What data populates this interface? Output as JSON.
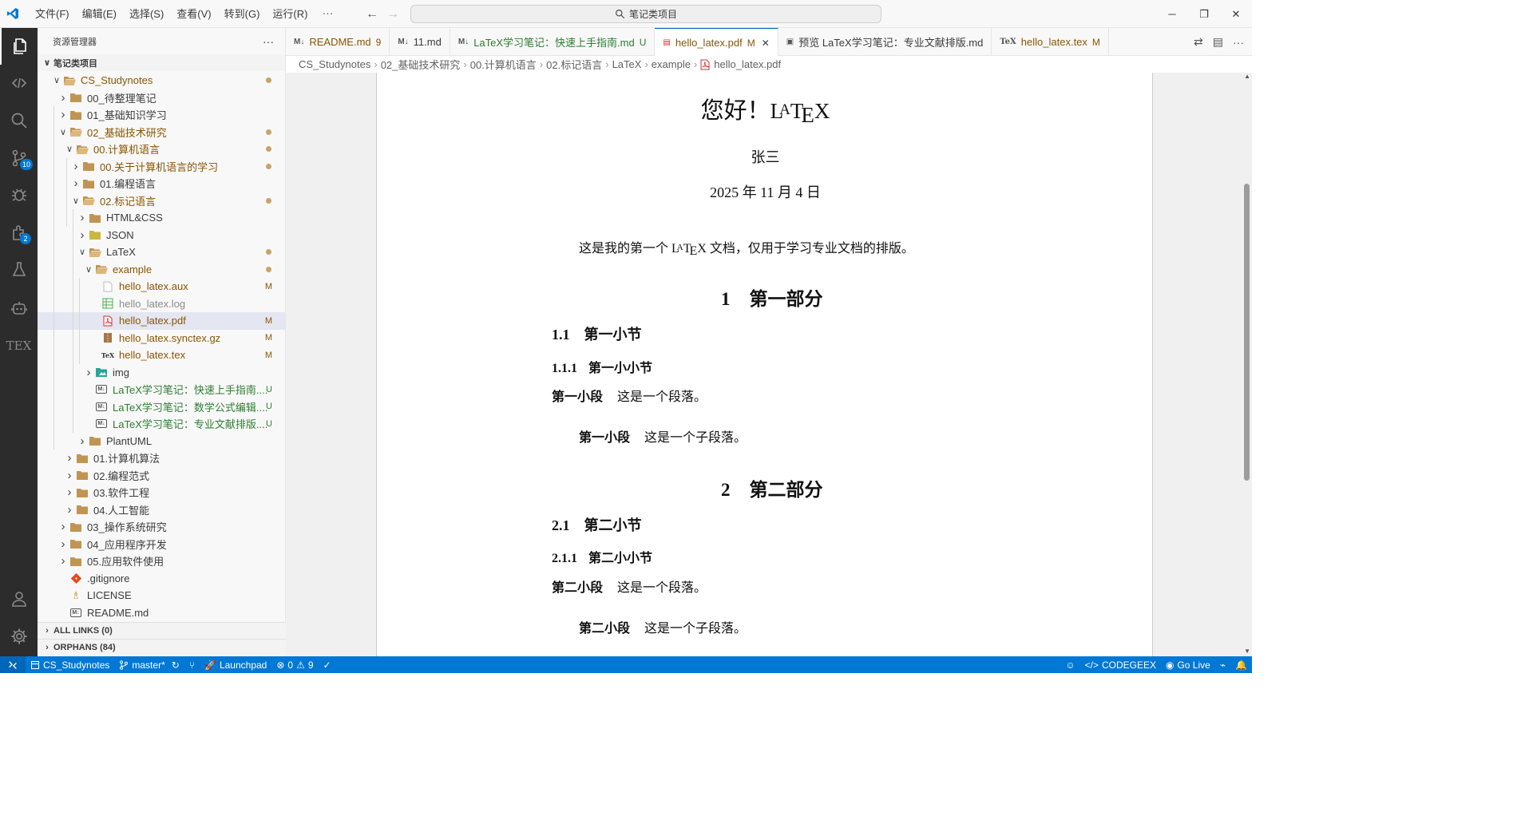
{
  "titlebar": {
    "menus": [
      "文件(F)",
      "编辑(E)",
      "选择(S)",
      "查看(V)",
      "转到(G)",
      "运行(R)"
    ],
    "more": "···",
    "search": "笔记类项目",
    "win_min": "─",
    "win_max": "❐",
    "win_close": "✕"
  },
  "activitybar": {
    "scm_badge": "10",
    "ext_badge": "2",
    "tex_label": "TEX"
  },
  "sidebar": {
    "title": "资源管理器",
    "more": "···",
    "root": "笔记类项目",
    "tree": [
      {
        "label": "CS_Studynotes",
        "depth": 0,
        "type": "folder-open",
        "twisty": "v",
        "color": "mod",
        "deco": "dot"
      },
      {
        "label": "00_待整理笔记",
        "depth": 1,
        "type": "folder",
        "twisty": ">"
      },
      {
        "label": "01_基础知识学习",
        "depth": 1,
        "type": "folder",
        "twisty": ">"
      },
      {
        "label": "02_基础技术研究",
        "depth": 1,
        "type": "folder-open",
        "twisty": "v",
        "color": "mod",
        "deco": "dot"
      },
      {
        "label": "00.计算机语言",
        "depth": 2,
        "type": "folder-open",
        "twisty": "v",
        "color": "mod",
        "deco": "dot"
      },
      {
        "label": "00.关于计算机语言的学习",
        "depth": 3,
        "type": "folder",
        "twisty": ">",
        "color": "mod",
        "deco": "dot"
      },
      {
        "label": "01.编程语言",
        "depth": 3,
        "type": "folder",
        "twisty": ">"
      },
      {
        "label": "02.标记语言",
        "depth": 3,
        "type": "folder-open",
        "twisty": "v",
        "color": "mod",
        "deco": "dot"
      },
      {
        "label": "HTML&CSS",
        "depth": 4,
        "type": "folder",
        "twisty": ">"
      },
      {
        "label": "JSON",
        "depth": 4,
        "type": "folder-json",
        "twisty": ">"
      },
      {
        "label": "LaTeX",
        "depth": 4,
        "type": "folder-open",
        "twisty": "v",
        "deco": "dot"
      },
      {
        "label": "example",
        "depth": 5,
        "type": "folder-open",
        "twisty": "v",
        "color": "mod",
        "deco": "dot"
      },
      {
        "label": "hello_latex.aux",
        "depth": 6,
        "type": "file",
        "color": "mod",
        "deco": "M"
      },
      {
        "label": "hello_latex.log",
        "depth": 6,
        "type": "log",
        "color": "dim"
      },
      {
        "label": "hello_latex.pdf",
        "depth": 6,
        "type": "pdf",
        "color": "mod",
        "deco": "M",
        "selected": true
      },
      {
        "label": "hello_latex.synctex.gz",
        "depth": 6,
        "type": "gz",
        "color": "mod",
        "deco": "M"
      },
      {
        "label": "hello_latex.tex",
        "depth": 6,
        "type": "tex",
        "color": "mod",
        "deco": "M"
      },
      {
        "label": "img",
        "depth": 5,
        "type": "folder-img",
        "twisty": ">"
      },
      {
        "label": "LaTeX学习笔记：快速上手指南....",
        "depth": 5,
        "type": "md",
        "color": "new",
        "deco": "U"
      },
      {
        "label": "LaTeX学习笔记：数学公式编辑....",
        "depth": 5,
        "type": "md",
        "color": "new",
        "deco": "U"
      },
      {
        "label": "LaTeX学习笔记：专业文献排版....",
        "depth": 5,
        "type": "md",
        "color": "new",
        "deco": "U"
      },
      {
        "label": "PlantUML",
        "depth": 4,
        "type": "folder",
        "twisty": ">"
      },
      {
        "label": "01.计算机算法",
        "depth": 2,
        "type": "folder",
        "twisty": ">"
      },
      {
        "label": "02.编程范式",
        "depth": 2,
        "type": "folder",
        "twisty": ">"
      },
      {
        "label": "03.软件工程",
        "depth": 2,
        "type": "folder",
        "twisty": ">"
      },
      {
        "label": "04.人工智能",
        "depth": 2,
        "type": "folder",
        "twisty": ">"
      },
      {
        "label": "03_操作系统研究",
        "depth": 1,
        "type": "folder",
        "twisty": ">"
      },
      {
        "label": "04_应用程序开发",
        "depth": 1,
        "type": "folder",
        "twisty": ">"
      },
      {
        "label": "05.应用软件使用",
        "depth": 1,
        "type": "folder",
        "twisty": ">"
      },
      {
        "label": ".gitignore",
        "depth": 1,
        "type": "git"
      },
      {
        "label": "LICENSE",
        "depth": 1,
        "type": "license"
      },
      {
        "label": "README.md",
        "depth": 1,
        "type": "md"
      }
    ],
    "sections": [
      "ALL LINKS (0)",
      "ORPHANS (84)"
    ]
  },
  "tabs": [
    {
      "label": "README.md",
      "icon": "md",
      "deco": "9",
      "color": "mod"
    },
    {
      "label": "11.md",
      "icon": "md",
      "deco": "",
      "color": ""
    },
    {
      "label": "LaTeX学习笔记：快速上手指南.md",
      "icon": "md",
      "deco": "U",
      "color": "new"
    },
    {
      "label": "hello_latex.pdf",
      "icon": "pdf",
      "deco": "M",
      "color": "mod",
      "active": true
    },
    {
      "label": "预览 LaTeX学习笔记：专业文献排版.md",
      "icon": "preview",
      "deco": "",
      "color": ""
    },
    {
      "label": "hello_latex.tex",
      "icon": "tex",
      "deco": "M",
      "color": "mod"
    }
  ],
  "breadcrumbs": [
    "CS_Studynotes",
    "02_基础技术研究",
    "00.计算机语言",
    "02.标记语言",
    "LaTeX",
    "example",
    "hello_latex.pdf"
  ],
  "pdf": {
    "title_prefix": "您好！",
    "latex_logo": "LATEX",
    "author": "张三",
    "date": "2025 年 11 月 4 日",
    "abstract_prefix": "这是我的第一个",
    "abstract_suffix": "文档，仅用于学习专业文档的排版。",
    "sections": [
      {
        "num": "1",
        "title": "第一部分",
        "sub_num": "1.1",
        "sub_title": "第一小节",
        "subsub_num": "1.1.1",
        "subsub_title": "第一小小节",
        "para_title": "第一小段",
        "para_text": "这是一个段落。",
        "subpara_title": "第一小段",
        "subpara_text": "这是一个子段落。"
      },
      {
        "num": "2",
        "title": "第二部分",
        "sub_num": "2.1",
        "sub_title": "第二小节",
        "subsub_num": "2.1.1",
        "subsub_title": "第二小小节",
        "para_title": "第二小段",
        "para_text": "这是一个段落。",
        "subpara_title": "第二小段",
        "subpara_text": "这是一个子段落。"
      }
    ]
  },
  "statusbar": {
    "workspace": "CS_Studynotes",
    "branch": "master*",
    "launchpad": "Launchpad",
    "errors": "0",
    "warnings": "9",
    "codegeex": "CODEGEEX",
    "golive": "Go Live"
  },
  "colors": {
    "accent": "#0078d4",
    "modified": "#895503",
    "untracked": "#2e7d32",
    "folder": "#c09553"
  }
}
